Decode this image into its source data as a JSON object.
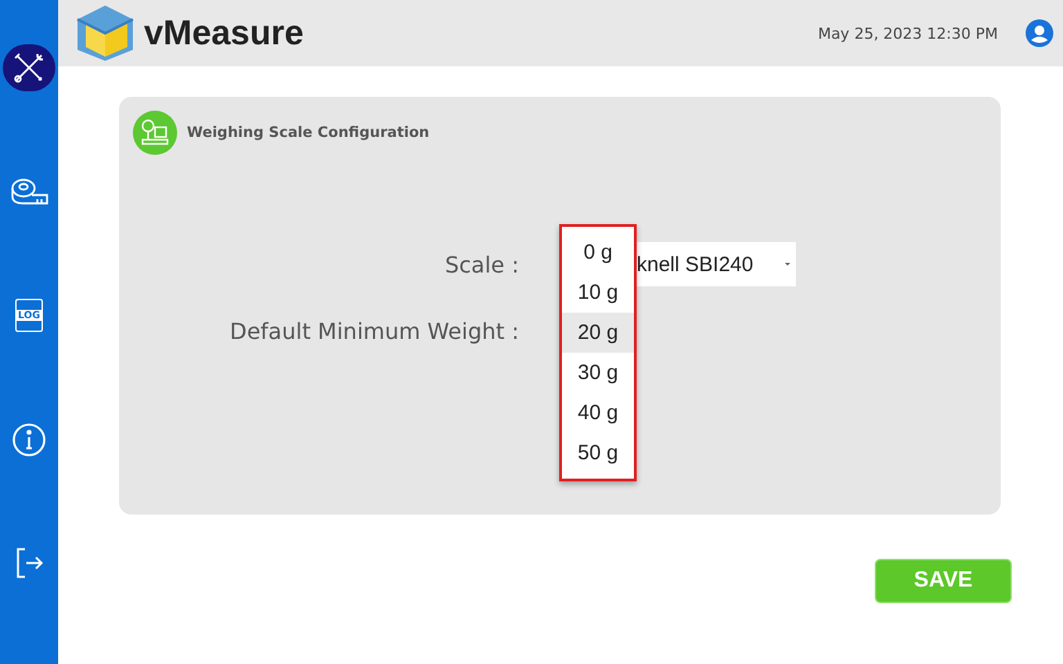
{
  "header": {
    "app_name": "vMeasure",
    "datetime": "May 25, 2023 12:30 PM"
  },
  "sidebar": {
    "items": [
      {
        "kind": "tools",
        "selected": true
      },
      {
        "kind": "tape",
        "selected": false
      },
      {
        "kind": "log",
        "selected": false,
        "icon_text": "LOG"
      },
      {
        "kind": "info",
        "selected": false
      },
      {
        "kind": "logout",
        "selected": false
      }
    ]
  },
  "card": {
    "title": "Weighing Scale Configuration",
    "fields": [
      {
        "label": "Scale :",
        "value": "knell SBI240"
      },
      {
        "label": "Default Minimum Weight :"
      }
    ]
  },
  "dropdown": {
    "options": [
      {
        "label": "0 g",
        "selected": false
      },
      {
        "label": "10 g",
        "selected": false
      },
      {
        "label": "20 g",
        "selected": true
      },
      {
        "label": "30 g",
        "selected": false
      },
      {
        "label": "40 g",
        "selected": false
      },
      {
        "label": "50 g",
        "selected": false
      }
    ]
  },
  "save_button": "SAVE"
}
